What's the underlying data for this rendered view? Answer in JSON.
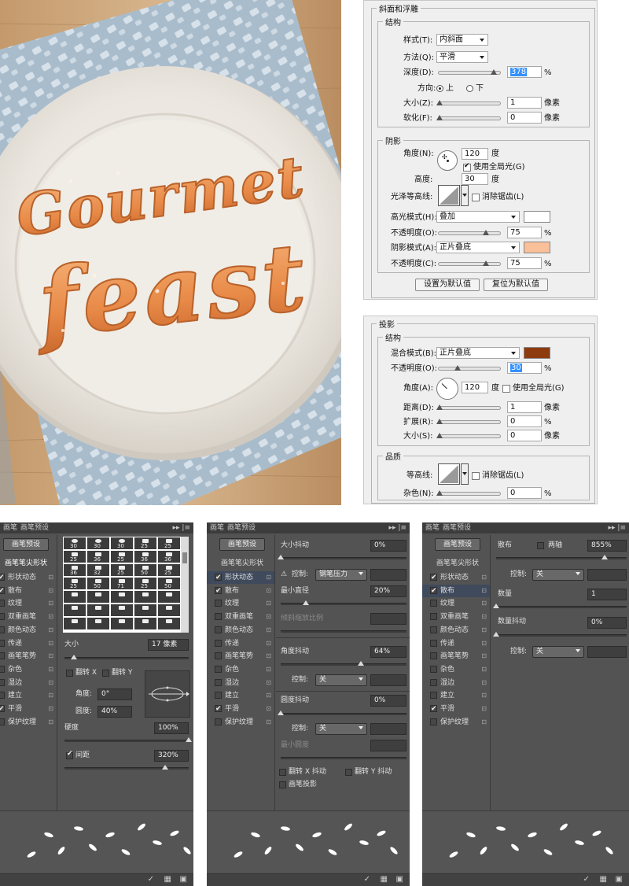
{
  "bevel_panel": {
    "title": "斜面和浮雕",
    "structure_legend": "结构",
    "style_label": "样式(T):",
    "style_value": "内斜面",
    "method_label": "方法(Q):",
    "method_value": "平滑",
    "depth_label": "深度(D):",
    "depth_value": "378",
    "percent": "%",
    "direction_label": "方向:",
    "dir_up": "上",
    "dir_down": "下",
    "size_label": "大小(Z):",
    "size_value": "1",
    "pixel": "像素",
    "soften_label": "软化(F):",
    "soften_value": "0",
    "shading_legend": "阴影",
    "angle_label": "角度(N):",
    "angle_value": "120",
    "degree": "度",
    "global_light": "使用全局光(G)",
    "altitude_label": "高度:",
    "altitude_value": "30",
    "gloss_label": "光泽等高线:",
    "anti_alias": "消除锯齿(L)",
    "highlight_label": "高光模式(H):",
    "highlight_value": "叠加",
    "highlight_color": "#ffffff",
    "opacity_label": "不透明度(O):",
    "opacity1_value": "75",
    "shadow_mode_label": "阴影模式(A):",
    "shadow_mode_value": "正片叠底",
    "shadow_color": "#f9c09a",
    "opacity2_label": "不透明度(C):",
    "opacity2_value": "75",
    "set_default": "设置为默认值",
    "reset_default": "复位为默认值"
  },
  "shadow_panel": {
    "title": "投影",
    "structure_legend": "结构",
    "blend_label": "混合模式(B):",
    "blend_value": "正片叠底",
    "blend_color": "#8e3a0f",
    "opacity_label": "不透明度(O):",
    "opacity_value": "30",
    "percent": "%",
    "angle_label": "角度(A):",
    "angle_value": "120",
    "degree": "度",
    "global_light": "使用全局光(G)",
    "distance_label": "距离(D):",
    "distance_value": "1",
    "spread_label": "扩展(R):",
    "spread_value": "0",
    "size_label": "大小(S):",
    "size_value": "0",
    "pixel": "像素",
    "quality_legend": "品质",
    "contour_label": "等高线:",
    "anti_alias": "消除锯齿(L)",
    "noise_label": "杂色(N):",
    "noise_value": "0"
  },
  "brush_common": {
    "tab_brush": "画笔",
    "tab_presets": "画笔预设",
    "preset_button": "画笔预设",
    "tip_shape": "画笔笔尖形状",
    "items": [
      "形状动态",
      "散布",
      "纹理",
      "双重画笔",
      "颜色动态",
      "传递",
      "画笔笔势",
      "杂色",
      "湿边",
      "建立",
      "平滑",
      "保护纹理"
    ],
    "checked": [
      true,
      true,
      false,
      false,
      false,
      false,
      false,
      false,
      false,
      false,
      true,
      false
    ],
    "menu_icon": "▸▸ |≡"
  },
  "brush1": {
    "tip_sizes": [
      "30",
      "30",
      "30",
      "25",
      "25",
      "25",
      "36",
      "25",
      "36",
      "36",
      "36",
      "32",
      "25",
      "50",
      "25",
      "25",
      "50",
      "71",
      "25",
      "50"
    ],
    "size_label": "大小",
    "size_value": "17 像素",
    "flip_x": "翻转 X",
    "flip_y": "翻转 Y",
    "angle_label": "角度:",
    "angle_value": "0°",
    "roundness_label": "圆度:",
    "roundness_value": "40%",
    "hardness_label": "硬度",
    "hardness_value": "100%",
    "spacing_label": "间距",
    "spacing_value": "320%"
  },
  "brush2": {
    "size_jitter_label": "大小抖动",
    "size_jitter_value": "0%",
    "control_label": "控制:",
    "control_value_pen": "钢笔压力",
    "min_diameter_label": "最小直径",
    "min_diameter_value": "20%",
    "tilt_scale_label": "倾斜缩放比例",
    "angle_jitter_label": "角度抖动",
    "angle_jitter_value": "64%",
    "control_off": "关",
    "roundness_jitter_label": "圆度抖动",
    "roundness_jitter_value": "0%",
    "min_roundness_label": "最小圆度",
    "flip_x_jitter": "翻转 X 抖动",
    "flip_y_jitter": "翻转 Y 抖动",
    "brush_projection": "画笔投影"
  },
  "brush3": {
    "scatter_label": "散布",
    "both_axes": "两轴",
    "scatter_value": "855%",
    "control_label": "控制:",
    "control_off": "关",
    "count_label": "数量",
    "count_value": "1",
    "count_jitter_label": "数量抖动",
    "count_jitter_value": "0%"
  },
  "artwork": {
    "line1": "Gourmet",
    "line2": "feast"
  }
}
